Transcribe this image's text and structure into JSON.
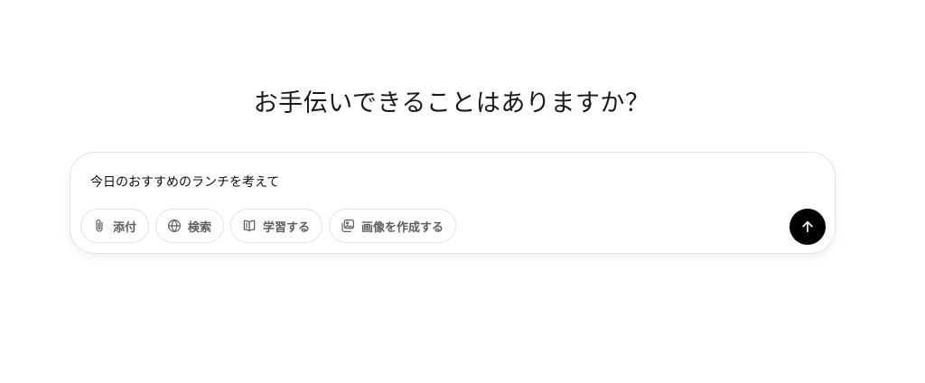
{
  "headline": "お手伝いできることはありますか？",
  "composer": {
    "prompt_text": "今日のおすすめのランチを考えて",
    "tools": [
      {
        "label": "添付",
        "icon": "paperclip-icon"
      },
      {
        "label": "検索",
        "icon": "globe-icon"
      },
      {
        "label": "学習する",
        "icon": "book-icon"
      },
      {
        "label": "画像を作成する",
        "icon": "image-icon"
      }
    ],
    "send_icon": "arrow-up-icon"
  },
  "colors": {
    "background": "#ffffff",
    "text": "#0d0d0d",
    "muted": "#5d5d5d",
    "border": "#e3e3e3",
    "send_button": "#000000"
  }
}
